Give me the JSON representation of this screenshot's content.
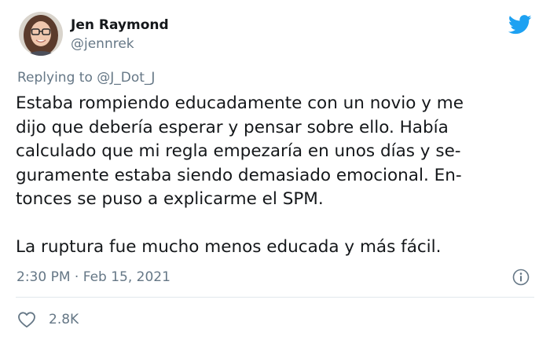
{
  "author": {
    "name": "Jen Raymond",
    "handle": "@jennrek"
  },
  "reply_context": {
    "prefix": "Replying to",
    "mention": "@J_Dot_J"
  },
  "tweet": {
    "lines": [
      "Estaba rompiendo educadamente con un novio y me",
      "dijo que debería esperar y pensar sobre ello. Había",
      "calculado que mi regla empezaría en unos días y se-",
      "guramente estaba siendo demasiado emocional. En-",
      "tonces se puso a explicarme el SPM."
    ],
    "last_line": "La ruptura fue mucho menos educada y más fácil."
  },
  "meta": {
    "time": "2:30 PM",
    "separator": "·",
    "date": "Feb 15, 2021"
  },
  "engagement": {
    "likes": "2.8K"
  },
  "icons": {
    "brand": "twitter-bird-icon",
    "info": "info-icon",
    "like": "heart-icon"
  },
  "colors": {
    "twitter_blue": "#1da1f2",
    "text": "#14171a",
    "secondary": "#657786",
    "divider": "#e1e8ed"
  }
}
